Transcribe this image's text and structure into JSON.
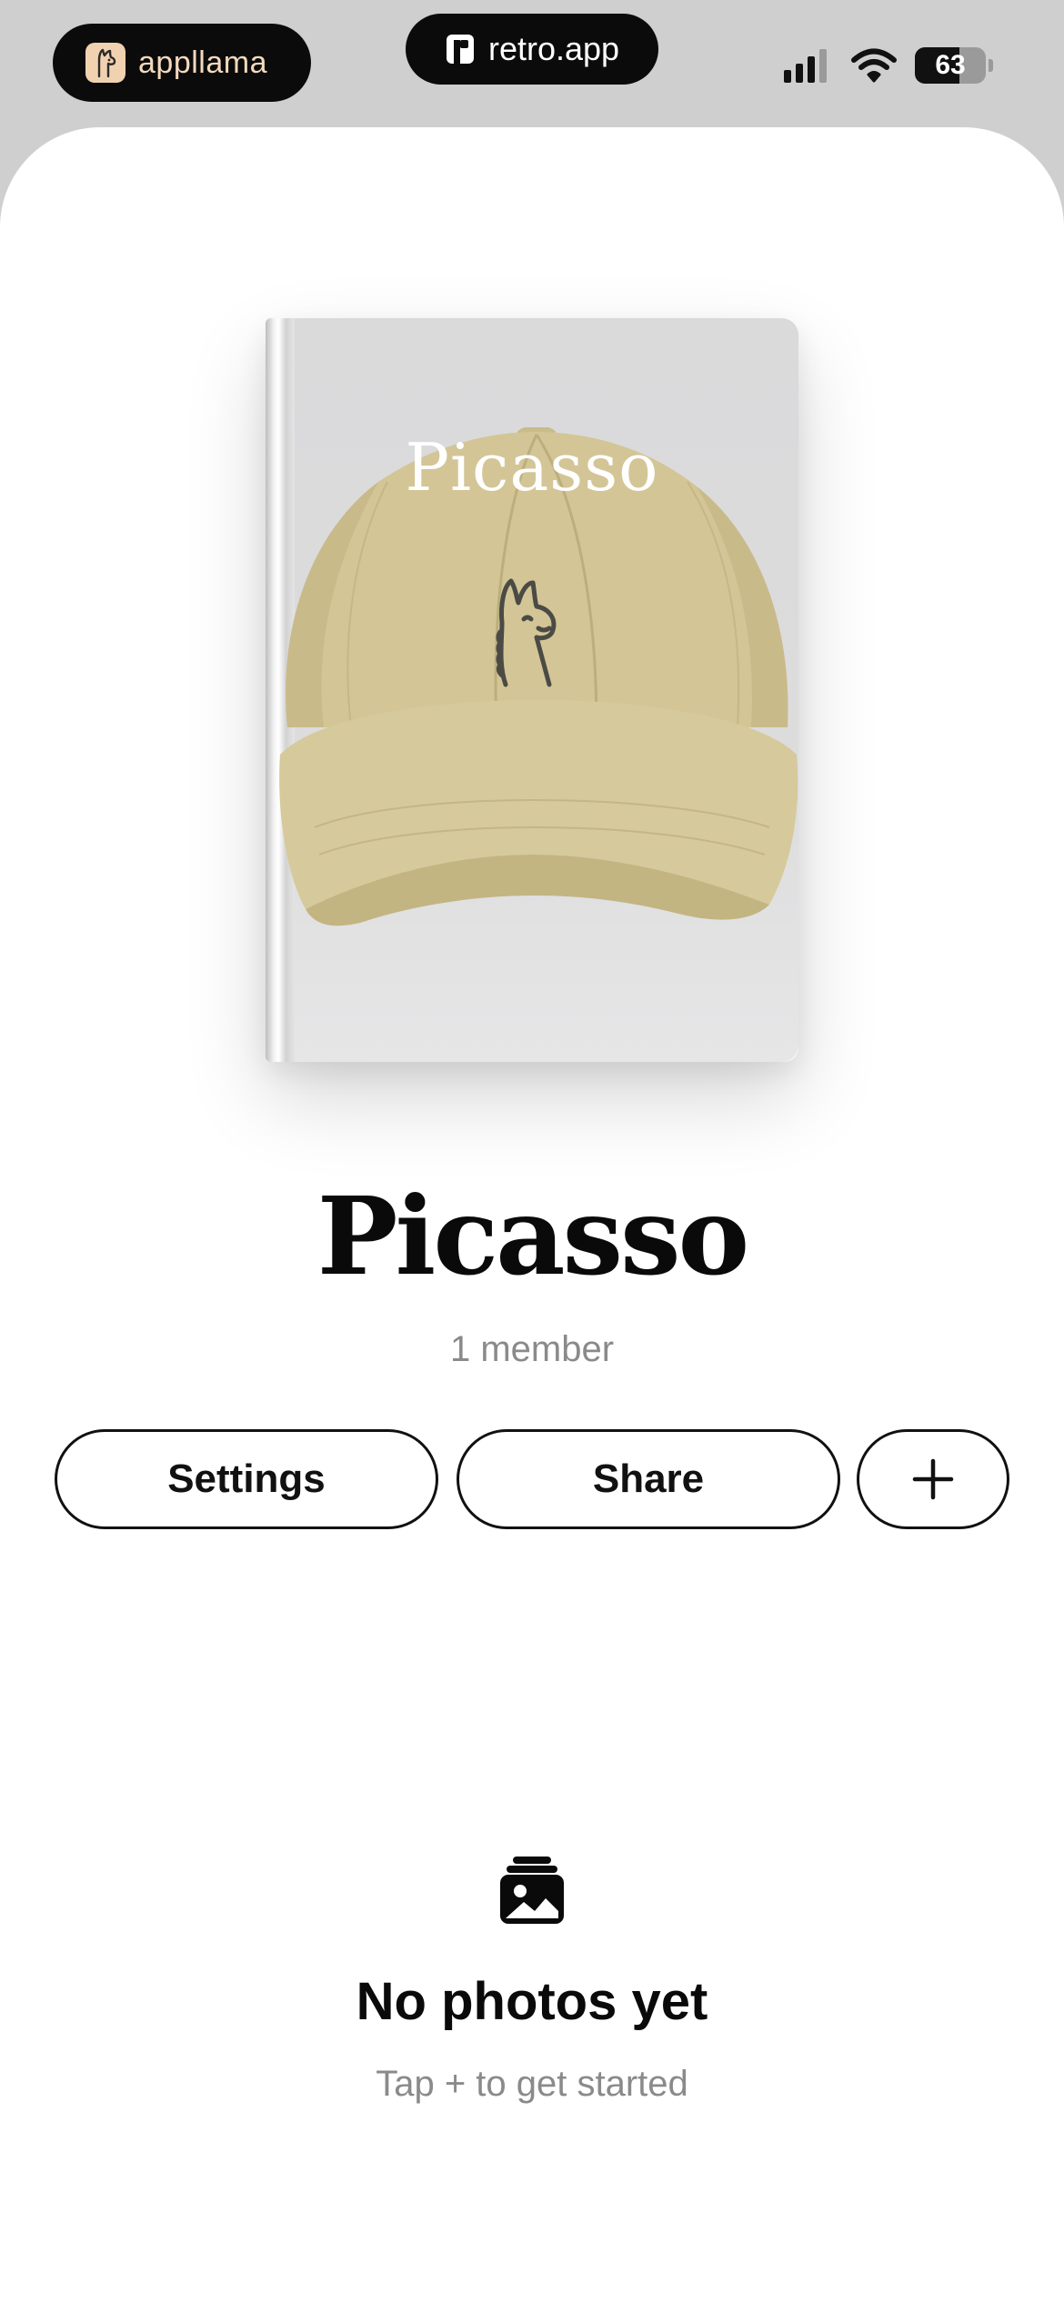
{
  "status_bar": {
    "left_app_name": "appllama",
    "center_app_name": "retro.app",
    "battery_percent": "63",
    "signal_bars": 4
  },
  "album": {
    "cover_title": "Picasso",
    "title": "Picasso",
    "member_count": "1 member"
  },
  "actions": {
    "settings_label": "Settings",
    "share_label": "Share",
    "add_label": "+"
  },
  "empty_state": {
    "title": "No photos yet",
    "subtitle": "Tap + to get started",
    "icon": "photo-stack-icon"
  },
  "colors": {
    "background": "#cfcfcf",
    "sheet": "#ffffff",
    "cap": "#d3c596",
    "text_primary": "#0a0a0a",
    "text_secondary": "#8a8a8a"
  }
}
